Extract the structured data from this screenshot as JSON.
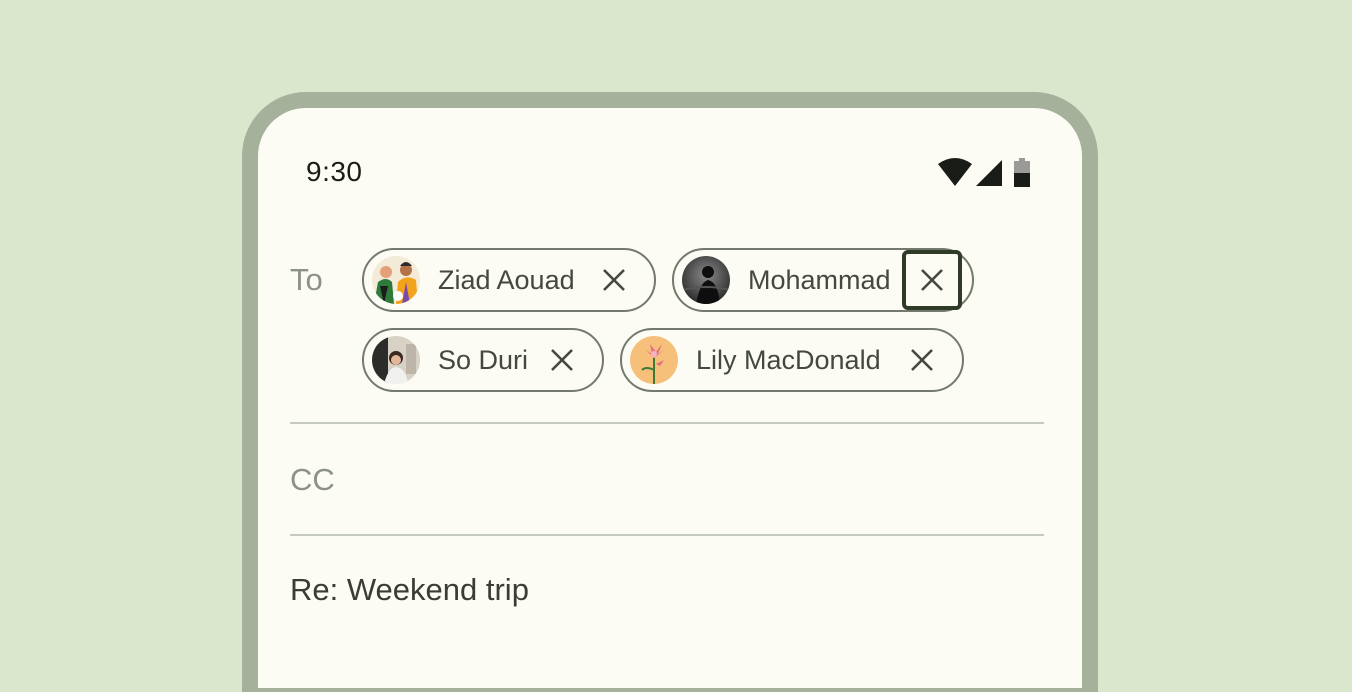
{
  "status_bar": {
    "time": "9:30",
    "icons": [
      "wifi-icon",
      "signal-icon",
      "battery-icon"
    ]
  },
  "compose": {
    "to_label": "To",
    "cc_label": "CC",
    "subject": "Re: Weekend trip",
    "recipients": [
      {
        "name": "Ziad Aouad",
        "avatar": "avatar-ziad",
        "focused": false
      },
      {
        "name": "Mohammad",
        "avatar": "avatar-mohammad",
        "focused": true
      },
      {
        "name": "So Duri",
        "avatar": "avatar-so-duri",
        "focused": false
      },
      {
        "name": "Lily MacDonald",
        "avatar": "avatar-lily",
        "focused": false
      }
    ]
  },
  "colors": {
    "background": "#dbe7cc",
    "device_frame": "#a6b19b",
    "screen": "#fcfcf4",
    "chip_outline": "#74796d",
    "focus_ring": "#2f3a28"
  }
}
